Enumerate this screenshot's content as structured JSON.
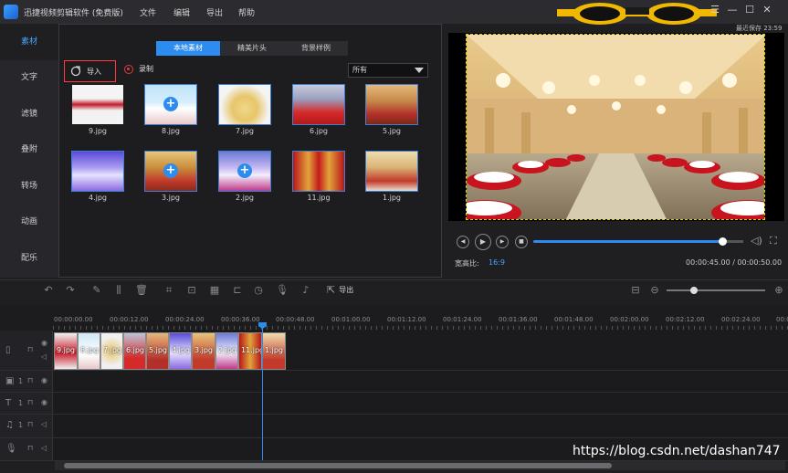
{
  "titlebar": {
    "title": "迅捷视频剪辑软件 (免费版)",
    "menus": [
      "文件",
      "编辑",
      "导出",
      "帮助"
    ],
    "save_info": "最近保存 23:59"
  },
  "nav": {
    "items": [
      "素材",
      "文字",
      "滤镜",
      "叠附",
      "转场",
      "动画",
      "配乐"
    ],
    "active_index": 0
  },
  "media": {
    "tabs": [
      "本地素材",
      "精美片头",
      "背景样例"
    ],
    "active_tab": 0,
    "import_label": "导入",
    "record_label": "录制",
    "filter_value": "所有",
    "files": [
      "9.jpg",
      "8.jpg",
      "7.jpg",
      "6.jpg",
      "5.jpg",
      "4.jpg",
      "3.jpg",
      "2.jpg",
      "11.jpg",
      "1.jpg"
    ]
  },
  "preview": {
    "ratio_label": "宽高比:",
    "ratio_value": "16:9",
    "time": "00:00:45.00 / 00:00:50.00",
    "progress": 0.9
  },
  "toolbar": {
    "export_label": "导出"
  },
  "timeline": {
    "ticks": [
      "00:00:00.00",
      "00:00:12.00",
      "00:00:24.00",
      "00:00:36.00",
      "00:00:48.00",
      "00:01:00.00",
      "00:01:12.00",
      "00:01:24.00",
      "00:01:36.00",
      "00:01:48.00",
      "00:02:00.00",
      "00:02:12.00",
      "00:02:24.00",
      "00:02:3"
    ],
    "clips": [
      "9.jpg",
      "8.jpg",
      "7.jpg",
      "6.jpg",
      "5.jpg",
      "4.jpg",
      "3.jpg",
      "2.jpg",
      "11.jpg",
      "1.jpg"
    ],
    "track_numbers": [
      "1",
      "1",
      "1"
    ]
  },
  "watermark": "https://blog.csdn.net/dashan747"
}
